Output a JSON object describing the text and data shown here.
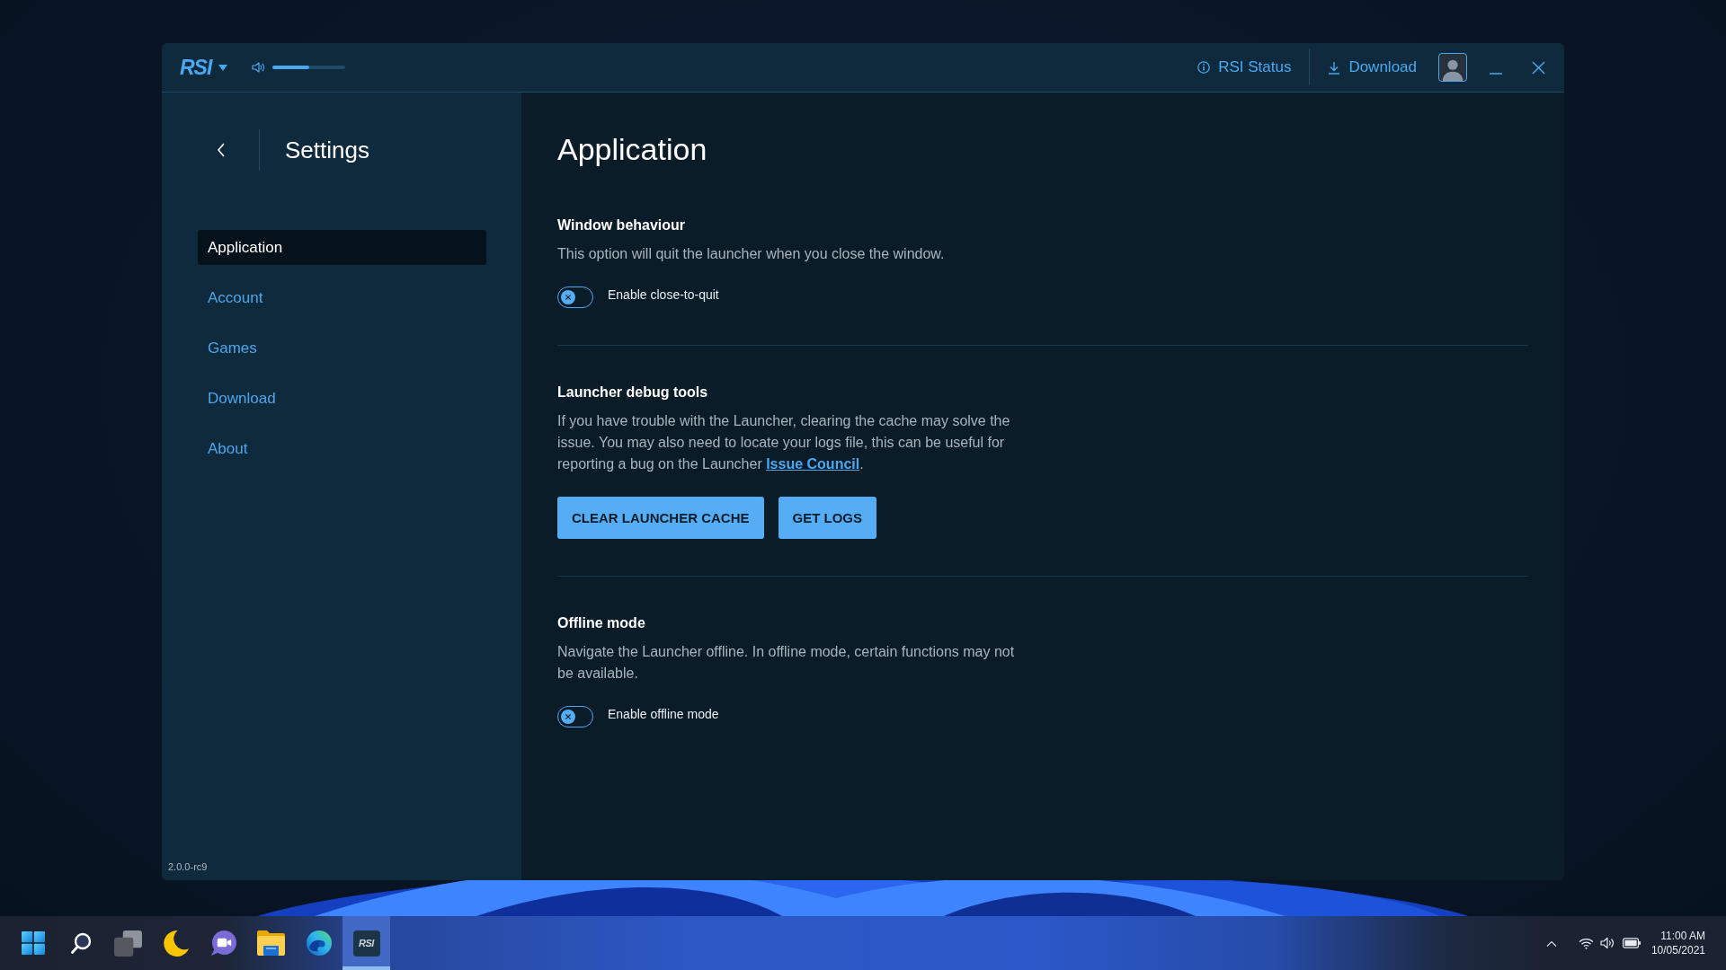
{
  "window": {
    "logo": "RSI",
    "volume": {
      "level": 0.5
    },
    "links": [
      {
        "kind": "status",
        "label": "RSI Status"
      },
      {
        "kind": "download",
        "label": "Download"
      }
    ]
  },
  "sidebar": {
    "title": "Settings",
    "items": [
      {
        "label": "Application",
        "selected": true
      },
      {
        "label": "Account",
        "selected": false
      },
      {
        "label": "Games",
        "selected": false
      },
      {
        "label": "Download",
        "selected": false
      },
      {
        "label": "About",
        "selected": false
      }
    ],
    "version": "2.0.0-rc9"
  },
  "page": {
    "title": "Application",
    "sections": [
      {
        "kind": "toggle",
        "heading": "Window behaviour",
        "text": "This option will quit the launcher when you close the window.",
        "toggle": {
          "label": "Enable close-to-quit",
          "on": false
        }
      },
      {
        "kind": "actions",
        "heading": "Launcher debug tools",
        "text": "If you have trouble with the Launcher, clearing the cache may solve the issue. You may also need to locate your logs file, this can be useful for reporting a bug on the Launcher ",
        "link": "Issue Council",
        "text_end": ".",
        "buttons": [
          "CLEAR LAUNCHER CACHE",
          "GET LOGS"
        ]
      },
      {
        "kind": "toggle",
        "heading": "Offline mode",
        "text": "Navigate the Launcher offline. In offline mode, certain functions may not be available.",
        "toggle": {
          "label": "Enable offline mode",
          "on": false
        }
      }
    ]
  },
  "taskbar": {
    "apps": [
      {
        "kind": "start",
        "selected": false
      },
      {
        "kind": "search",
        "selected": false
      },
      {
        "kind": "task_view",
        "selected": false
      },
      {
        "kind": "moon",
        "selected": false
      },
      {
        "kind": "chat",
        "selected": false
      },
      {
        "kind": "explorer",
        "selected": false
      },
      {
        "kind": "edge",
        "selected": false
      },
      {
        "kind": "rsi",
        "label": "RSI",
        "selected": true
      }
    ],
    "clock": {
      "time": "11:00 AM",
      "date": "10/05/2021"
    }
  }
}
